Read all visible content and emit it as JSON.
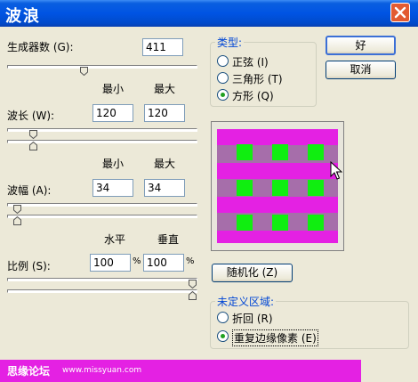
{
  "window": {
    "title": "波浪"
  },
  "generators": {
    "label": "生成器数 (G):",
    "value": "411",
    "slider_fraction": 0.4
  },
  "wavelength": {
    "min_header": "最小",
    "max_header": "最大",
    "label": "波长 (W):",
    "min": "120",
    "max": "120",
    "slider_min_fraction": 0.12,
    "slider_max_fraction": 0.12
  },
  "amplitude": {
    "min_header": "最小",
    "max_header": "最大",
    "label": "波幅 (A):",
    "min": "34",
    "max": "34",
    "slider_min_fraction": 0.03,
    "slider_max_fraction": 0.03
  },
  "scale": {
    "h_header": "水平",
    "v_header": "垂直",
    "label": "比例 (S):",
    "h": "100",
    "v": "100",
    "unit": "%",
    "slider_h_fraction": 1.0,
    "slider_v_fraction": 1.0
  },
  "type_group": {
    "title": "类型:",
    "options": [
      {
        "label": "正弦 (I)",
        "checked": false
      },
      {
        "label": "三角形 (T)",
        "checked": false
      },
      {
        "label": "方形 (Q)",
        "checked": true
      }
    ]
  },
  "buttons": {
    "ok": "好",
    "cancel": "取消",
    "randomize": "随机化 (Z)"
  },
  "undefined_group": {
    "title": "未定义区域:",
    "options": [
      {
        "label": "折回 (R)",
        "checked": false
      },
      {
        "label": "重复边缘像素 (E)",
        "checked": true
      }
    ]
  },
  "watermark": {
    "text": "思缘论坛",
    "url": "www.missyuan.com"
  },
  "colors": {
    "magenta": "#e421e3",
    "green": "#10ee10",
    "title_blue": "#0054e3"
  }
}
